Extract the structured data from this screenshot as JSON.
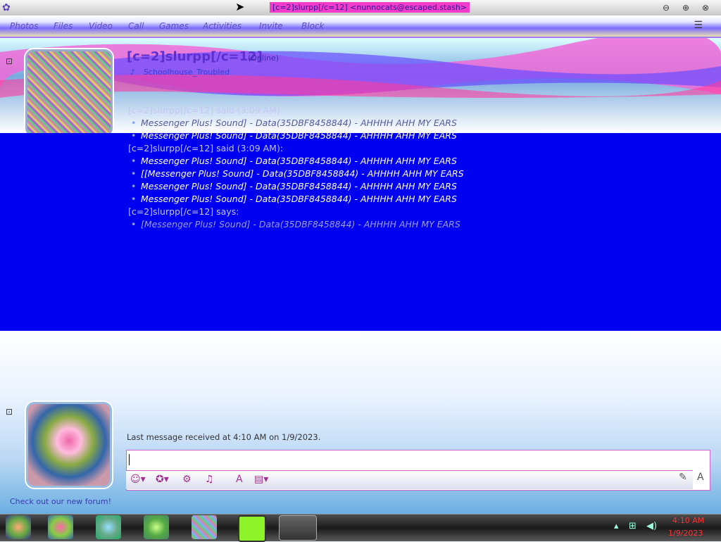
{
  "window": {
    "title": "[c=2]slurpp[/c=12] <nunnocats@escaped.stash>",
    "controls": [
      "minimize",
      "maximize",
      "close"
    ]
  },
  "menu": {
    "items": [
      "Photos",
      "Files",
      "Video",
      "Call",
      "Games",
      "Activities",
      "Invite",
      "Block"
    ]
  },
  "contact": {
    "name": "[c=2]slurpp[/c=12]",
    "status": "(Online)",
    "email": "Schoolhouse_Troubled"
  },
  "conversation": {
    "lines": [
      {
        "type": "said",
        "text": "[c=2]slurpp[/c=12] said (3:09 AM):"
      },
      {
        "type": "msg",
        "text": "Messenger Plus! Sound] - Data(35DBF8458844) - AHHHH AHH MY EARS",
        "style": "first"
      },
      {
        "type": "msg",
        "text": "Messenger Plus! Sound] - Data(35DBF8458844) - AHHHH AHH MY EARS",
        "style": "normal"
      },
      {
        "type": "said",
        "text": "[c=2]slurpp[/c=12] said (3:09 AM):"
      },
      {
        "type": "msg",
        "text": "Messenger Plus! Sound] - Data(35DBF8458844) - AHHHH AHH MY EARS",
        "style": "normal"
      },
      {
        "type": "msg",
        "text": "[[Messenger Plus! Sound] - Data(35DBF8458844) - AHHHH AHH MY EARS",
        "style": "normal"
      },
      {
        "type": "msg",
        "text": "Messenger Plus! Sound] - Data(35DBF8458844) - AHHHH AHH MY EARS",
        "style": "normal"
      },
      {
        "type": "msg",
        "text": "Messenger Plus! Sound] - Data(35DBF8458844) - AHHHH AHH MY EARS",
        "style": "normal"
      },
      {
        "type": "said",
        "text": "[c=2]slurpp[/c=12] says:"
      },
      {
        "type": "msg",
        "text": "[Messenger Plus! Sound] - Data(35DBF8458844) - AHHHH AHH MY EARS",
        "style": "faded"
      }
    ]
  },
  "status_bar": {
    "last_message": "Last message received at 4:10 AM on 1/9/2023."
  },
  "input": {
    "value": ""
  },
  "sidebar": {
    "forum_link": "Check out our new forum!"
  },
  "clock": {
    "time": "4:10 AM",
    "date": "1/9/2023"
  },
  "icons": {
    "toolbar": [
      "emoticon-icon",
      "wink-icon",
      "nudge-icon",
      "voice-clip-icon",
      "font-icon",
      "background-icon"
    ],
    "taskbar": [
      "messenger-app-icon",
      "browser-app-icon",
      "chat-app-icon",
      "media-app-icon",
      "photo-app-icon",
      "green-app-icon",
      "active-chat-icon"
    ],
    "tray": [
      "tray-arrow-icon",
      "network-icon",
      "volume-icon"
    ]
  }
}
